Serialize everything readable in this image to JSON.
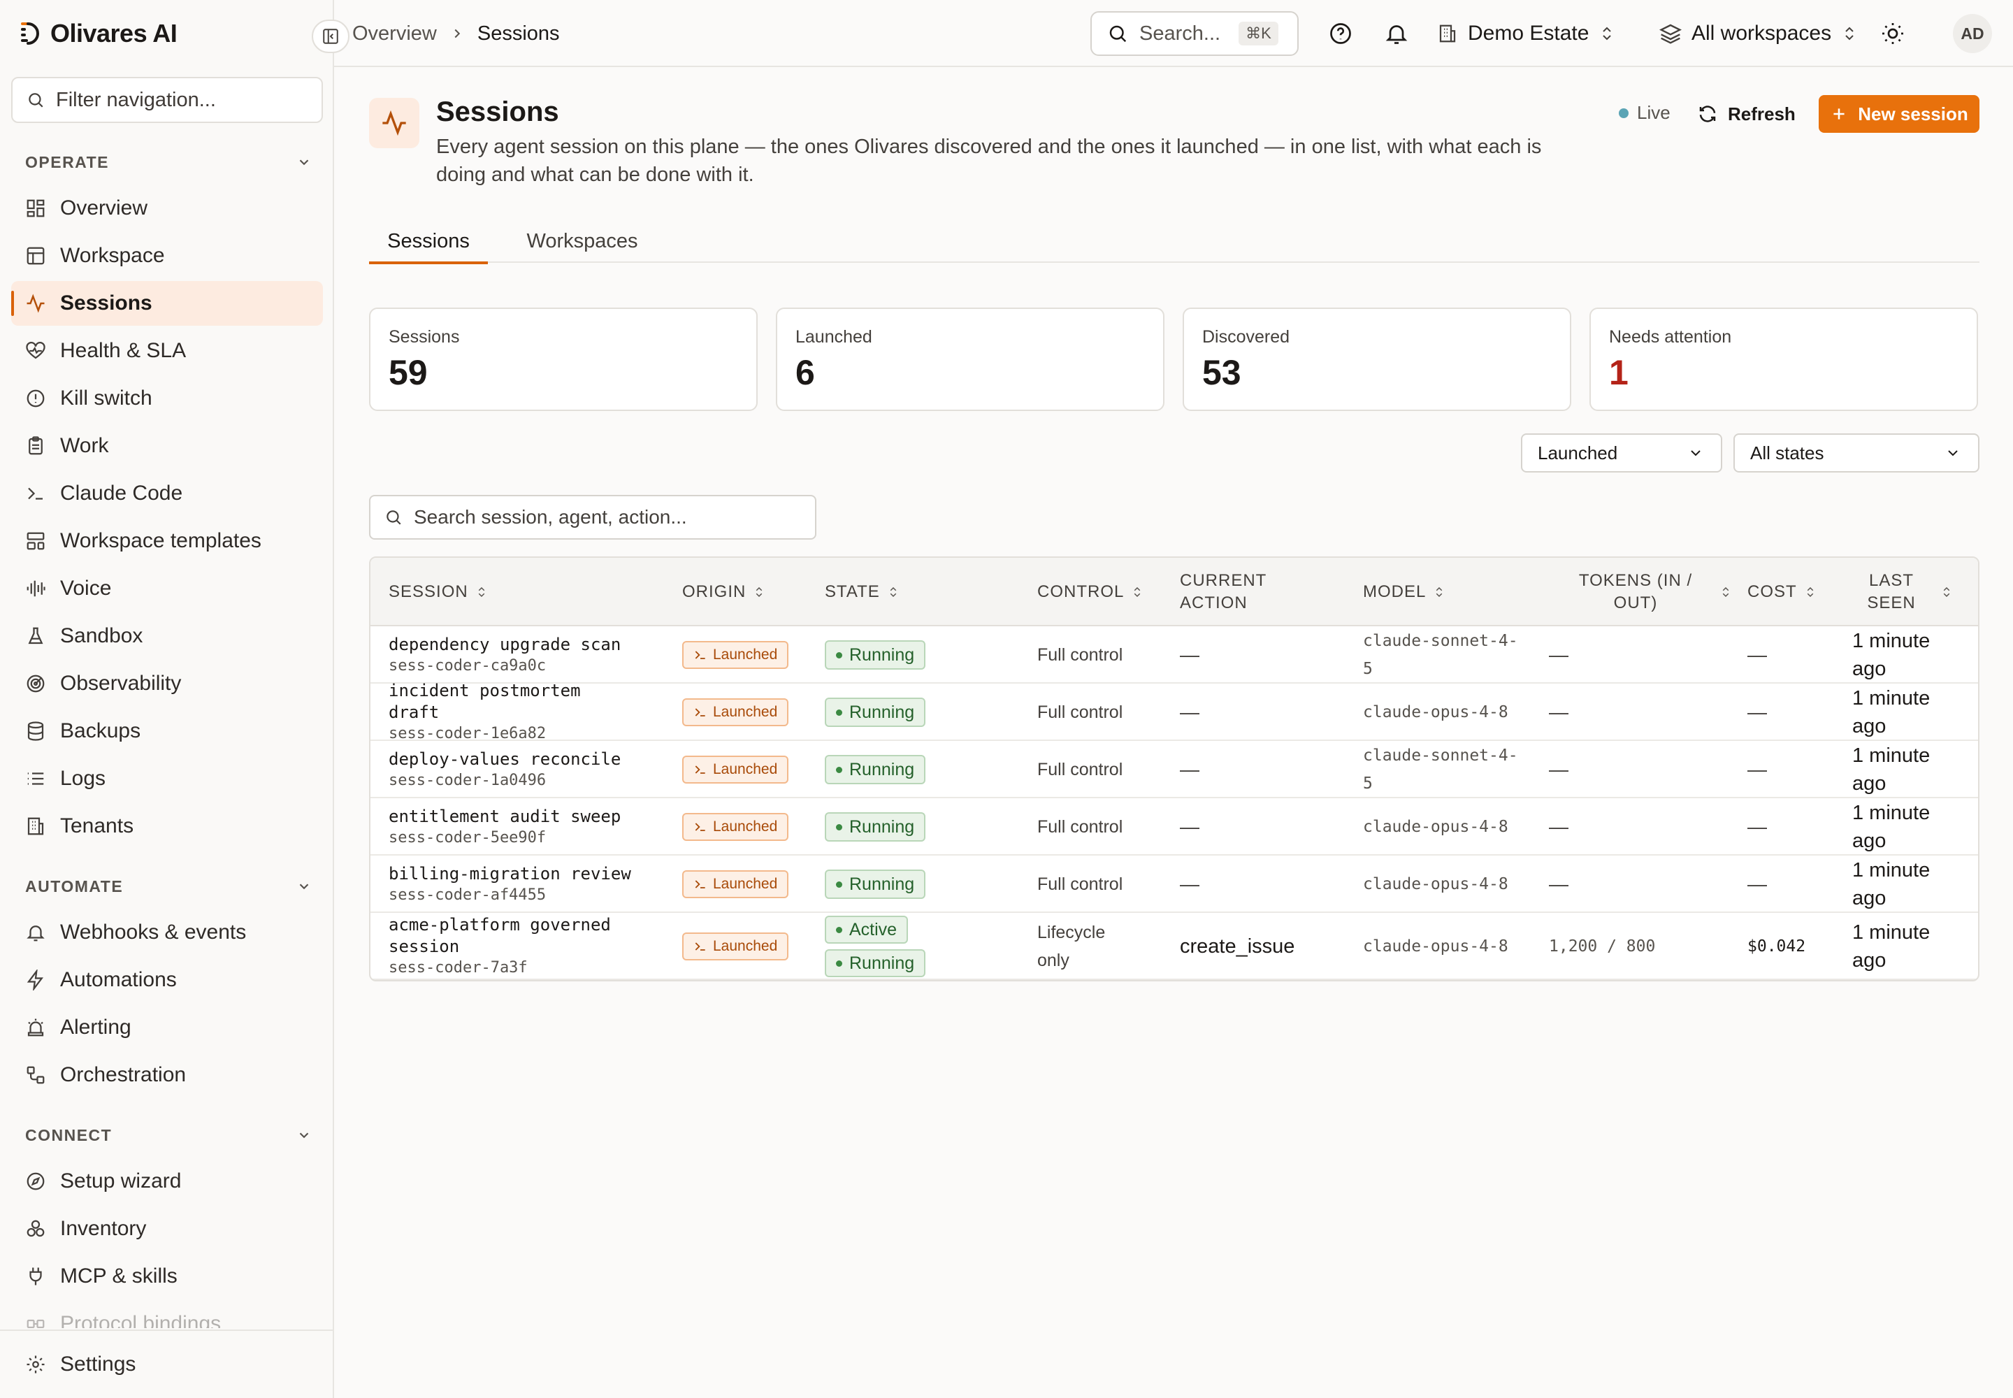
{
  "brand": {
    "name": "Olivares AI"
  },
  "nav_filter": {
    "placeholder": "Filter navigation..."
  },
  "nav": {
    "sections": [
      {
        "label": "OPERATE",
        "items": [
          {
            "label": "Overview",
            "icon": "grid-icon"
          },
          {
            "label": "Workspace",
            "icon": "layout-icon"
          },
          {
            "label": "Sessions",
            "icon": "activity-icon",
            "active": true
          },
          {
            "label": "Health & SLA",
            "icon": "heart-pulse-icon"
          },
          {
            "label": "Kill switch",
            "icon": "alert-circle-icon"
          },
          {
            "label": "Work",
            "icon": "clipboard-icon"
          },
          {
            "label": "Claude Code",
            "icon": "terminal-icon"
          },
          {
            "label": "Workspace templates",
            "icon": "template-icon"
          },
          {
            "label": "Voice",
            "icon": "audio-lines-icon"
          },
          {
            "label": "Sandbox",
            "icon": "flask-icon"
          },
          {
            "label": "Observability",
            "icon": "radar-icon"
          },
          {
            "label": "Backups",
            "icon": "database-icon"
          },
          {
            "label": "Logs",
            "icon": "list-icon"
          },
          {
            "label": "Tenants",
            "icon": "building-icon"
          }
        ]
      },
      {
        "label": "AUTOMATE",
        "items": [
          {
            "label": "Webhooks & events",
            "icon": "bell-icon"
          },
          {
            "label": "Automations",
            "icon": "zap-icon"
          },
          {
            "label": "Alerting",
            "icon": "siren-icon"
          },
          {
            "label": "Orchestration",
            "icon": "workflow-icon"
          }
        ]
      },
      {
        "label": "CONNECT",
        "items": [
          {
            "label": "Setup wizard",
            "icon": "compass-icon"
          },
          {
            "label": "Inventory",
            "icon": "boxes-icon"
          },
          {
            "label": "MCP & skills",
            "icon": "plug-icon"
          },
          {
            "label": "Protocol bindings",
            "icon": "binding-icon"
          }
        ]
      }
    ],
    "settings": "Settings"
  },
  "topbar": {
    "breadcrumb": [
      "Overview",
      "Sessions"
    ],
    "search_label": "Search...",
    "search_kbd": "⌘K",
    "estate": "Demo Estate",
    "workspaces": "All workspaces",
    "avatar": "AD"
  },
  "page": {
    "title": "Sessions",
    "description": "Every agent session on this plane — the ones Olivares discovered and the ones it launched — in one list, with what each is doing and what can be done with it.",
    "live": "Live",
    "refresh": "Refresh",
    "new_session": "New session",
    "tabs": [
      "Sessions",
      "Workspaces"
    ]
  },
  "stats": [
    {
      "label": "Sessions",
      "value": "59"
    },
    {
      "label": "Launched",
      "value": "6"
    },
    {
      "label": "Discovered",
      "value": "53"
    },
    {
      "label": "Needs attention",
      "value": "1",
      "color": "#b42318"
    }
  ],
  "filters": {
    "origin": "Launched",
    "state": "All states",
    "search_placeholder": "Search session, agent, action..."
  },
  "table": {
    "headers": [
      "SESSION",
      "ORIGIN",
      "STATE",
      "CONTROL",
      "CURRENT ACTION",
      "MODEL",
      "TOKENS (IN / OUT)",
      "COST",
      "LAST SEEN"
    ],
    "rows": [
      {
        "name": "dependency upgrade scan",
        "id": "sess-coder-ca9a0c",
        "origin": "Launched",
        "states": [
          "Running"
        ],
        "control": "Full control",
        "action": "—",
        "model": "claude-sonnet-4-5",
        "tokens": "—",
        "cost": "—",
        "seen": "1 minute ago"
      },
      {
        "name": "incident postmortem draft",
        "id": "sess-coder-1e6a82",
        "origin": "Launched",
        "states": [
          "Running"
        ],
        "control": "Full control",
        "action": "—",
        "model": "claude-opus-4-8",
        "tokens": "—",
        "cost": "—",
        "seen": "1 minute ago"
      },
      {
        "name": "deploy-values reconcile",
        "id": "sess-coder-1a0496",
        "origin": "Launched",
        "states": [
          "Running"
        ],
        "control": "Full control",
        "action": "—",
        "model": "claude-sonnet-4-5",
        "tokens": "—",
        "cost": "—",
        "seen": "1 minute ago"
      },
      {
        "name": "entitlement audit sweep",
        "id": "sess-coder-5ee90f",
        "origin": "Launched",
        "states": [
          "Running"
        ],
        "control": "Full control",
        "action": "—",
        "model": "claude-opus-4-8",
        "tokens": "—",
        "cost": "—",
        "seen": "1 minute ago"
      },
      {
        "name": "billing-migration review",
        "id": "sess-coder-af4455",
        "origin": "Launched",
        "states": [
          "Running"
        ],
        "control": "Full control",
        "action": "—",
        "model": "claude-opus-4-8",
        "tokens": "—",
        "cost": "—",
        "seen": "1 minute ago"
      },
      {
        "name": "acme-platform governed session",
        "id": "sess-coder-7a3f",
        "origin": "Launched",
        "states": [
          "Active",
          "Running"
        ],
        "control": "Lifecycle only",
        "action": "create_issue",
        "model": "claude-opus-4-8",
        "tokens": "1,200 / 800",
        "cost": "$0.042",
        "seen": "1 minute ago"
      }
    ]
  },
  "colors": {
    "accent": "#e8710c",
    "active_nav_bg": "#fdebe0",
    "running_bg": "#e9f3e8",
    "launched_bg": "#fdf0e6",
    "live_dot": "#5ba4b5"
  }
}
